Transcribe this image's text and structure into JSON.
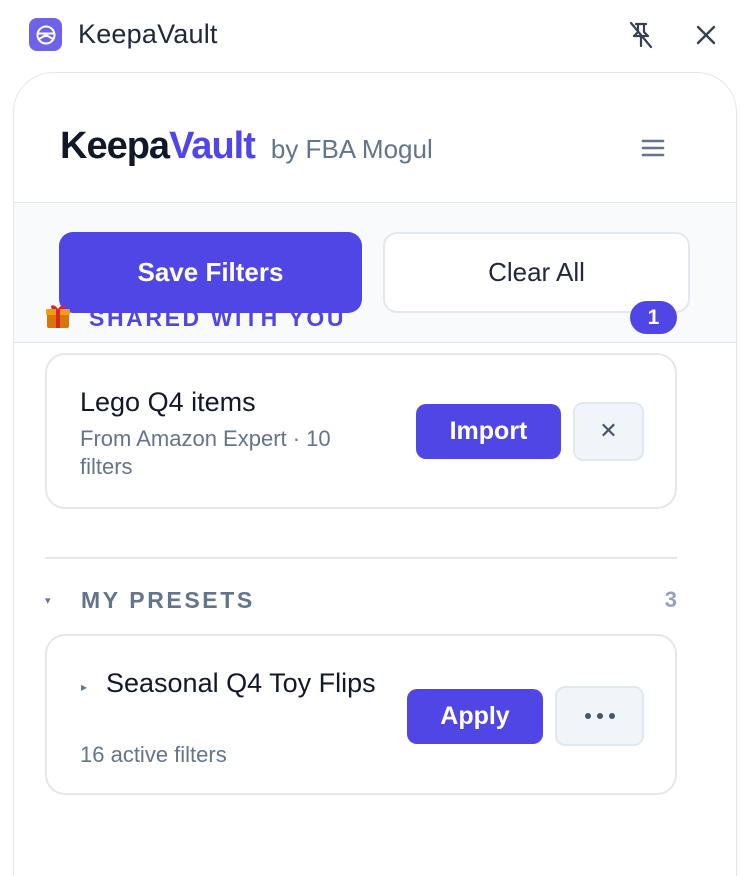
{
  "window": {
    "title": "KeepaVault",
    "icons": {
      "app": "steering-wheel-icon",
      "unpin": "unpin-icon",
      "close": "close-icon"
    }
  },
  "header": {
    "brand_part1": "Keepa",
    "brand_part2": "Vault",
    "byline": "by FBA Mogul",
    "menu_icon": "hamburger-menu-icon"
  },
  "actions": {
    "save_label": "Save Filters",
    "clear_label": "Clear All"
  },
  "shared": {
    "icon": "gift-icon",
    "title": "SHARED WITH YOU",
    "count": "1",
    "items": [
      {
        "name": "Lego Q4 items",
        "subtitle": "From Amazon Expert · 10 filters",
        "import_label": "Import",
        "dismiss_label": "✕"
      }
    ]
  },
  "presets": {
    "title": "MY PRESETS",
    "count": "3",
    "collapse_glyph": "▾",
    "items": [
      {
        "expand_glyph": "▸",
        "name": "Seasonal Q4 Toy Flips",
        "subtitle": "16 active filters",
        "apply_label": "Apply",
        "more_icon": "more-options-icon"
      }
    ]
  },
  "colors": {
    "accent": "#4f46e5",
    "muted_text": "#64748b",
    "border": "#e5e7eb",
    "bar_bg": "#f8fafc"
  }
}
